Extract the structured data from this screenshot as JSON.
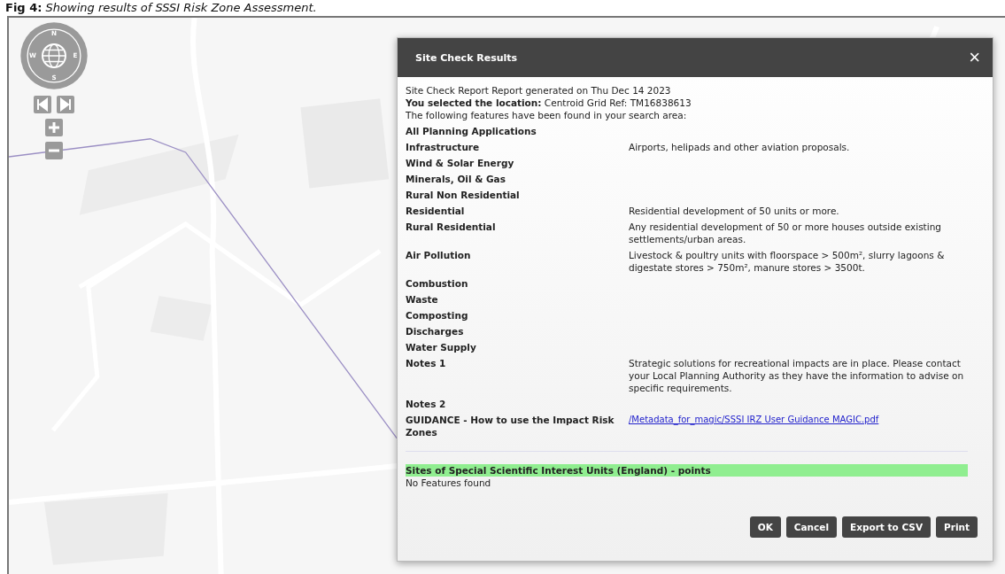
{
  "caption": {
    "figure": "Fig 4:",
    "text": "Showing results of SSSI Risk Zone Assessment."
  },
  "map": {
    "kind": "picture",
    "compass": [
      "N",
      "E",
      "S",
      "W"
    ]
  },
  "dialog": {
    "title": "Site Check Results",
    "close": "×",
    "intro": [
      "Site Check Report Report generated on Thu Dec 14 2023",
      "**You selected the location:** Centroid Grid Ref: TM16838613",
      "The following features have been found in your search area:"
    ],
    "rows": [
      {
        "label": "All Planning Applications",
        "value": ""
      },
      {
        "label": "Infrastructure",
        "value": "Airports, helipads and other aviation proposals."
      },
      {
        "label": "Wind & Solar Energy",
        "value": ""
      },
      {
        "label": "Minerals, Oil & Gas",
        "value": ""
      },
      {
        "label": "Rural Non Residential",
        "value": ""
      },
      {
        "label": "Residential",
        "value": "Residential development of 50 units or more."
      },
      {
        "label": "Rural Residential",
        "value": "Any residential development of 50 or more houses outside existing settlements/urban areas."
      },
      {
        "label": "Air Pollution",
        "value": "Livestock & poultry units with floorspace > 500m², slurry lagoons & digestate stores > 750m², manure stores > 3500t."
      },
      {
        "label": "Combustion",
        "value": ""
      },
      {
        "label": "Waste",
        "value": ""
      },
      {
        "label": "Composting",
        "value": ""
      },
      {
        "label": "Discharges",
        "value": ""
      },
      {
        "label": "Water Supply",
        "value": ""
      },
      {
        "label": "Notes 1",
        "value": "Strategic solutions for recreational impacts are in place. Please contact your Local Planning Authority as they have the information to advise on specific requirements."
      },
      {
        "label": "Notes 2",
        "value": ""
      }
    ],
    "guidance": {
      "label": "GUIDANCE - How to use the Impact Risk Zones",
      "link": "/Metadata_for_magic/SSSI IRZ User Guidance MAGIC.pdf"
    },
    "section": {
      "title": "Sites of Special Scientific Interest Units (England) - points",
      "text": "No Features found"
    },
    "buttons": [
      "OK",
      "Cancel",
      "Export to CSV",
      "Print"
    ]
  }
}
